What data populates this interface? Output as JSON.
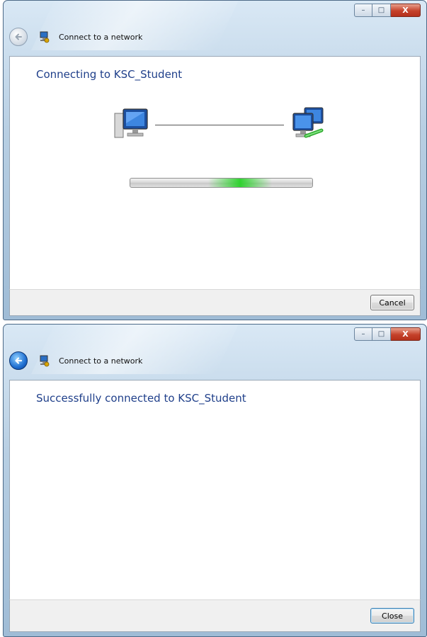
{
  "window1": {
    "nav_title": "Connect to a network",
    "heading": "Connecting to KSC_Student",
    "cancel_label": "Cancel",
    "progress_indeterminate": true
  },
  "window2": {
    "nav_title": "Connect to a network",
    "heading": "Successfully connected to KSC_Student",
    "close_label": "Close"
  },
  "caption_buttons": {
    "minimize": "–",
    "maximize": "□",
    "close": "X"
  },
  "icons": {
    "back": "back-arrow-icon",
    "network": "network-icon",
    "computer": "computer-icon",
    "network_computers": "network-computers-icon"
  },
  "colors": {
    "heading": "#1f3f8a",
    "progress_glow": "#28d228",
    "close_button": "#c5412a"
  }
}
